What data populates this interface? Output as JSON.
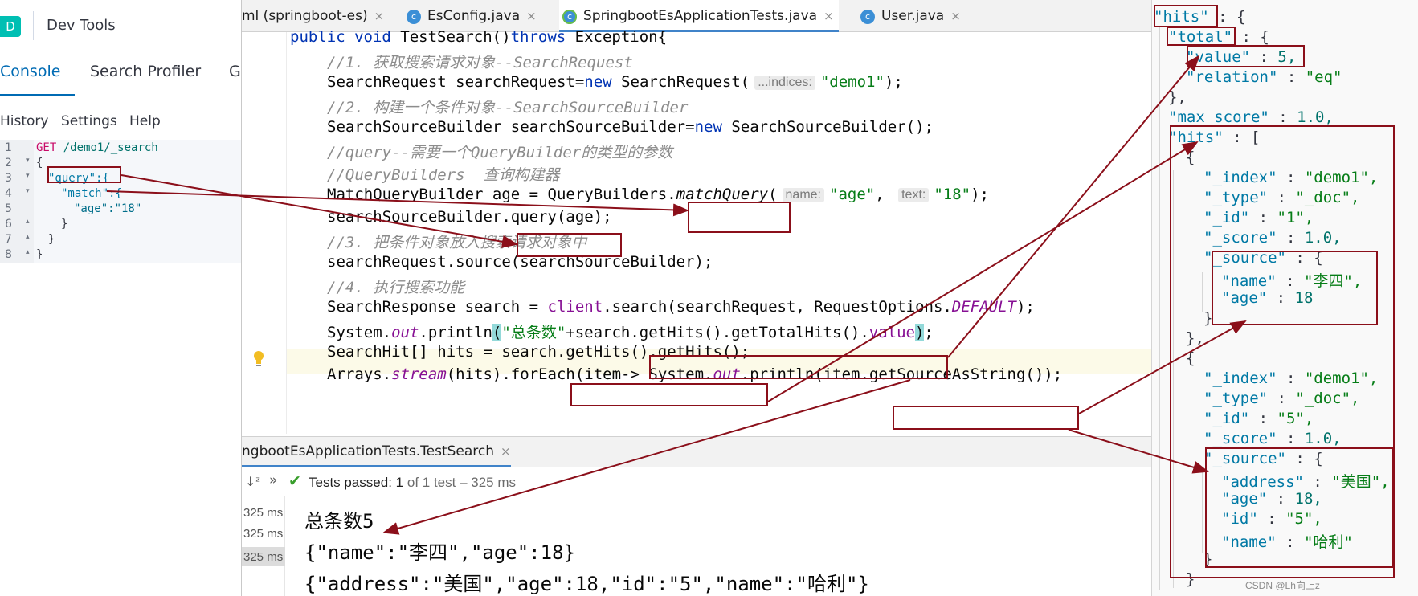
{
  "devtools": {
    "logo": "D",
    "title": "Dev Tools",
    "tabs": [
      "Console",
      "Search Profiler",
      "G"
    ],
    "menu": [
      "History",
      "Settings",
      "Help"
    ],
    "line_numbers": [
      "1",
      "2",
      "3",
      "4",
      "5",
      "6",
      "7",
      "8"
    ],
    "request": {
      "method": "GET",
      "path": "/demo1/_search"
    },
    "lines": [
      "{",
      "\"query\":{",
      "\"match\":{",
      "\"age\":\"18\"",
      "}",
      "}",
      "}"
    ]
  },
  "ide": {
    "tabs": [
      {
        "label": "ml (springboot-es)"
      },
      {
        "label": "EsConfig.java",
        "icon": "c"
      },
      {
        "label": "SpringbootEsApplicationTests.java",
        "icon": "c",
        "active": true
      },
      {
        "label": "User.java",
        "icon": "c"
      }
    ],
    "close_glyph": "×",
    "code": {
      "l1_kw1": "public void ",
      "l1_name": "TestSearch",
      "l1_rest1": "()",
      "l1_kw2": "throws ",
      "l1_rest2": "Exception{",
      "c1": "//1. 获取搜索请求对象--SearchRequest",
      "l3_a": "SearchRequest searchRequest=",
      "l3_new": "new ",
      "l3_b": "SearchRequest(",
      "l3_hint": "...indices:",
      "l3_str": "\"demo1\"",
      "l3_c": ");",
      "c2": "//2. 构建一个条件对象--SearchSourceBuilder",
      "l5_a": "SearchSourceBuilder searchSourceBuilder=",
      "l5_new": "new ",
      "l5_b": "SearchSourceBuilder();",
      "c3": "//query--需要一个QueryBuilder的类型的参数",
      "c4": "//QueryBuilders  查询构建器",
      "l8_a": "MatchQueryBuilder age = QueryBuilders.",
      "l8_m": "matchQuery",
      "l8_b": "(",
      "l8_hint1": "name:",
      "l8_s1": "\"age\"",
      "l8_comma": ", ",
      "l8_hint2": "text:",
      "l8_s2": "\"18\"",
      "l8_c": ");",
      "l9_a": "searchSourceBuilder.",
      "l9_b": "query(age);",
      "c5": "//3. 把条件对象放入搜索请求对象中",
      "l11": "searchRequest.source(searchSourceBuilder);",
      "c6": "//4. 执行搜索功能",
      "l13_a": "SearchResponse search = ",
      "l13_fld": "client",
      "l13_b": ".search(searchRequest, RequestOptions.",
      "l13_static": "DEFAULT",
      "l13_c": ");",
      "l14_a": "System.",
      "l14_out": "out",
      "l14_b": ".println",
      "l14_paren": "(",
      "l14_str": "\"总条数\"",
      "l14_c": "+search.",
      "l14_d": "getHits().getTotalHits().",
      "l14_val": "value",
      "l14_paren2": ")",
      "l14_e": ";",
      "l15_a": "SearchHit[] hits = search.",
      "l15_b": "getHits().getHits();",
      "l16_a": "Arrays.",
      "l16_stream": "stream",
      "l16_b": "(hits).forEach(item-> System.",
      "l16_out": "out",
      "l16_c": ".println(item.",
      "l16_d": "getSourceAsString()",
      "l16_e": ");"
    },
    "run": {
      "tab_label": "ngbootEsApplicationTests.TestSearch",
      "status_prefix": "Tests passed: ",
      "status_count": "1",
      "status_suffix": " of 1 test – 325 ms",
      "times": [
        "325 ms",
        "325 ms",
        "325 ms"
      ],
      "output": [
        "总条数5",
        "{\"name\":\"李四\",\"age\":18}",
        "{\"address\":\"美国\",\"age\":18,\"id\":\"5\",\"name\":\"哈利\"}"
      ]
    }
  },
  "json": {
    "k_hits": "\"hits\"",
    "k_total": "\"total\"",
    "k_value": "\"value\"",
    "v_value": "5,",
    "k_relation": "\"relation\"",
    "v_relation": "\"eq\"",
    "k_max_score": "\"max_score\"",
    "v_max_score": "1.0,",
    "k_hits_arr": "\"hits\"",
    "k_index": "\"_index\"",
    "v_index": "\"demo1\",",
    "k_type": "\"_type\"",
    "v_type": "\"_doc\",",
    "k_id": "\"_id\"",
    "v_id1": "\"1\",",
    "v_id2": "\"5\",",
    "k_score": "\"_score\"",
    "v_score": "1.0,",
    "k_source": "\"_source\"",
    "k_name": "\"name\"",
    "v_name1": "\"李四\",",
    "v_name2": "\"哈利\"",
    "k_age": "\"age\"",
    "v_age1": "18",
    "v_age2": "18,",
    "k_address": "\"address\"",
    "v_address": "\"美国\",",
    "k_id_field": "\"id\"",
    "v_id_field": "\"5\","
  },
  "watermark": "CSDN @Lh向上z",
  "colors": {
    "annotation": "#8b0f1a",
    "kibana_accent": "#006bb4",
    "ide_keyword": "#0033b3",
    "ide_string": "#067d17",
    "ide_comment": "#8c8c8c"
  }
}
